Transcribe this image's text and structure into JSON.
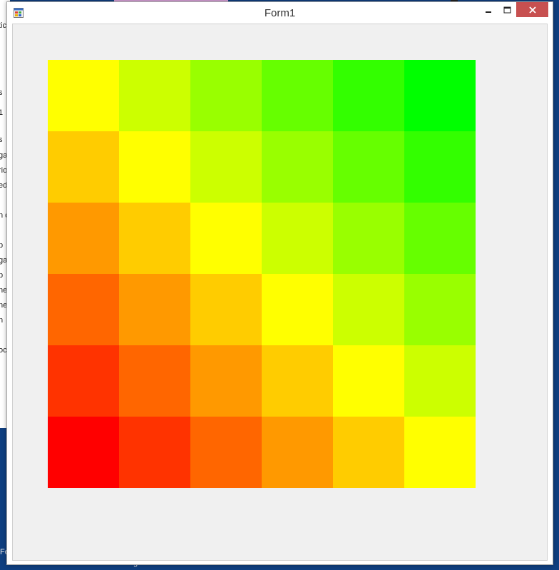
{
  "window": {
    "title": "Form1"
  },
  "controls": {
    "minimize_icon": "minimize-icon",
    "maximize_icon": "maximize-icon",
    "close_icon": "close-icon"
  },
  "heatmap": {
    "rows": 6,
    "cols": 6,
    "colors": [
      [
        "#ffff00",
        "#ccff00",
        "#99ff00",
        "#66ff00",
        "#33ff00",
        "#00ff00"
      ],
      [
        "#ffcc00",
        "#ffff00",
        "#ccff00",
        "#99ff00",
        "#66ff00",
        "#33ff00"
      ],
      [
        "#ff9900",
        "#ffcc00",
        "#ffff00",
        "#ccff00",
        "#99ff00",
        "#66ff00"
      ],
      [
        "#ff6600",
        "#ff9900",
        "#ffcc00",
        "#ffff00",
        "#ccff00",
        "#99ff00"
      ],
      [
        "#ff3300",
        "#ff6600",
        "#ff9900",
        "#ffcc00",
        "#ffff00",
        "#ccff00"
      ],
      [
        "#ff0000",
        "#ff3300",
        "#ff6600",
        "#ff9900",
        "#ffcc00",
        "#ffff00"
      ]
    ]
  },
  "background": {
    "taskbar_label": "graficos",
    "side_fragments": [
      "tic",
      "s",
      "1",
      "s",
      "ga",
      "rio",
      "ed",
      "n c",
      "p",
      "ga",
      "p",
      "ne",
      "ne",
      "n",
      "oc"
    ],
    "side_fragment_bottom": "Fo"
  },
  "colors": {
    "desktop": "#0f3f80",
    "close_button": "#c75050",
    "client_area": "#f0f0f0"
  }
}
